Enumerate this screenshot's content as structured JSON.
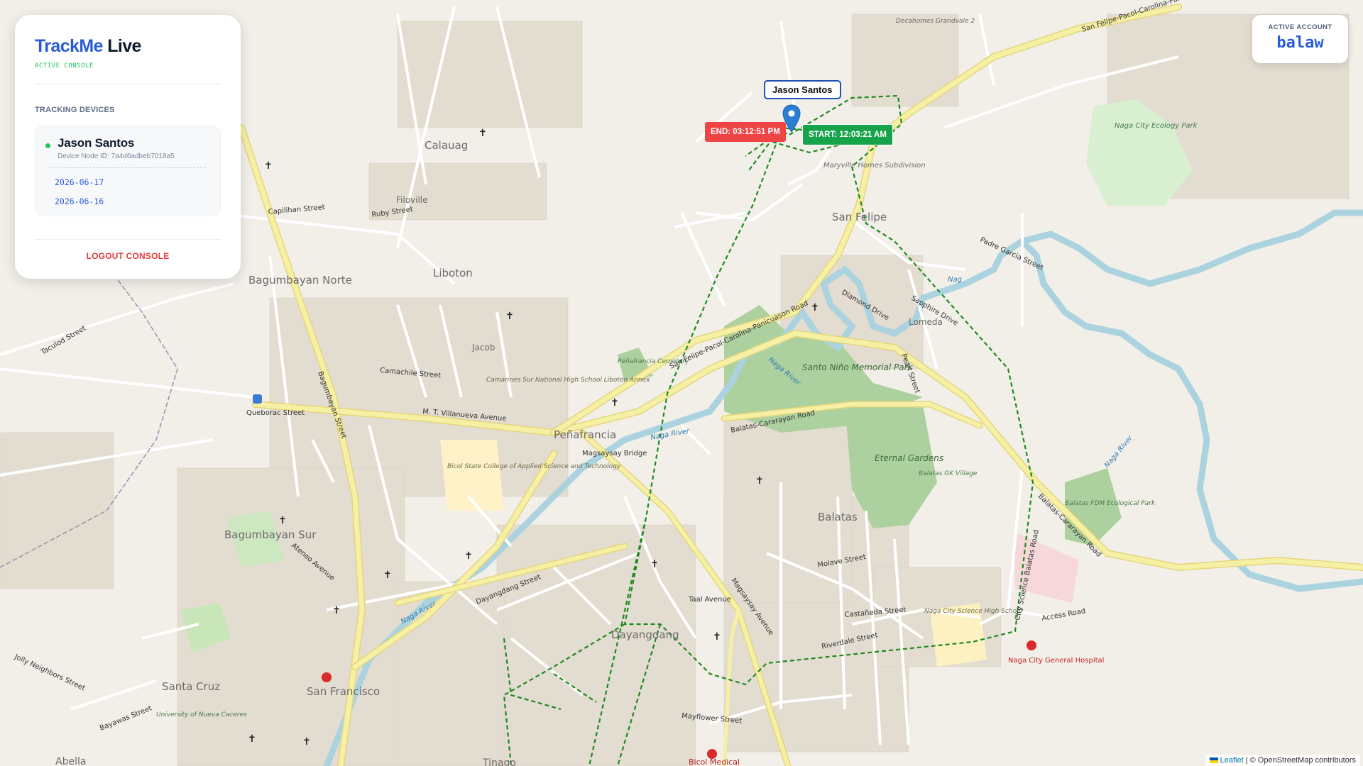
{
  "app": {
    "brand_part1": "TrackMe",
    "brand_part2": "Live",
    "subtitle": "ACTIVE CONSOLE"
  },
  "sidebar": {
    "section_label": "TRACKING DEVICES",
    "device": {
      "name": "Jason Santos",
      "node_id": "Device Node ID: 7a4d6adbeb7018a5",
      "status_color": "#22c55e"
    },
    "dates": [
      "2026-06-17",
      "2026-06-16"
    ],
    "logout_label": "LOGOUT CONSOLE"
  },
  "account": {
    "label": "ACTIVE ACCOUNT",
    "username": "balaw"
  },
  "map": {
    "marker_label": "Jason Santos",
    "end_label": "END: 03:12:51 PM",
    "start_label": "START: 12:03:21 AM",
    "route_color": "#1f8a1f",
    "attribution_link": "Leaflet",
    "attribution_text": "| © OpenStreetMap contributors",
    "place_labels": {
      "calauag": "Calauag",
      "filoville": "Filoville",
      "liboton": "Liboton",
      "bagumbayan_norte": "Bagumbayan Norte",
      "bagumbayan_sur": "Bagumbayan Sur",
      "penafrancia": "Peñafrancia",
      "san_felipe": "San Felipe",
      "lomeda": "Lomeda",
      "balatas": "Balatas",
      "dayangdang": "Dayangdang",
      "santa_cruz": "Santa Cruz",
      "san_francisco": "San Francisco",
      "jacob": "Jacob",
      "abella": "Abella",
      "tinago": "Tinago",
      "maryville": "Maryville Homes Subdivision",
      "naga_ecology": "Naga City Ecology Park",
      "santo_nino": "Santo Niño Memorial Park",
      "eternal_gardens": "Eternal Gardens",
      "balatas_gk": "Balatas GK Village",
      "balatas_fdm": "Balatas FDM Ecological Park",
      "naga_science": "Naga City Science High School",
      "naga_hospital": "Naga City General Hospital",
      "bicol_state": "Bicol State College of Applied Science and Technology",
      "camarines_sur": "Camarines Sur National High School Liboton Annex",
      "univ_nueva": "University of Nueva Caceres",
      "penafrancia_cem": "Peñafrancia Cemetery",
      "magsaysay_bridge": "Magsaysay Bridge",
      "decahomes": "Decahomes Grandvale 2",
      "bicol_medical": "Bicol Medical"
    },
    "street_labels": {
      "villanueva": "M. T. Villanueva Avenue",
      "balatas_cararayan": "Balatas-Cararayan Road",
      "balatas_cararayan2": "Balatas-Cararayan Road",
      "sanfelipe_pacol": "San Felipe-Pacol-Carolina-Panicuason Road",
      "sanfelipe_pacol2": "San Felipe-Pacol-Carolina-Panicuason Road",
      "magsaysay": "Magsaysay Avenue",
      "dayangdang_st": "Dayangdang Street",
      "taal": "Taal Avenue",
      "riverdale": "Riverdale Street",
      "castaneda": "Castañeda Street",
      "access": "Access Road",
      "padre_garcia": "Padre Garcia Street",
      "bagumbayan_st": "Bagumbayan Street",
      "capilihan": "Capilihan Street",
      "ruby": "Ruby Street",
      "camachile": "Camachile Street",
      "quebrac": "Queborac Street",
      "taculod": "Taculod Street",
      "jolly": "Jolly Neighbors Street",
      "bayawas": "Bayawas Street",
      "ateneo": "Ateneo Avenue",
      "city_science": "City Science Balatas Road",
      "mayflower": "Mayflower Street",
      "molave": "Molave Street",
      "sapphire": "Sapphire Drive",
      "diamond": "Diamond Drive",
      "pearl": "Pearl Street",
      "naga_river1": "Naga River",
      "naga_river2": "Naga River",
      "naga_river3": "Naga River",
      "naga_river4": "Naga River",
      "nag": "Nag"
    }
  }
}
